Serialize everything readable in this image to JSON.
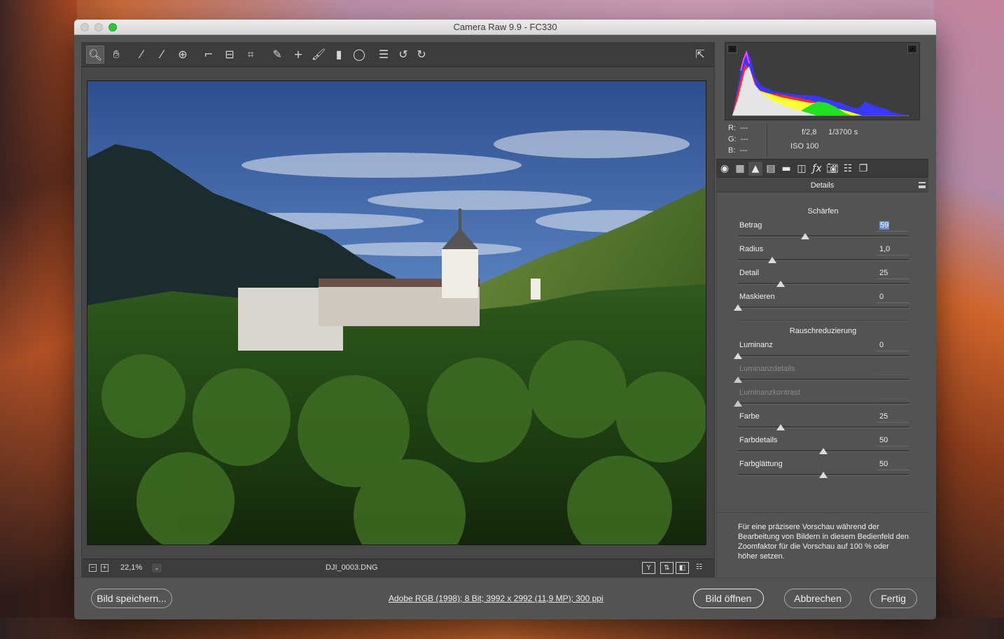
{
  "window": {
    "title": "Camera Raw 9.9 - FC330"
  },
  "toolbar": {
    "tools": [
      {
        "name": "zoom-tool-icon",
        "glyph": "🔍︎"
      },
      {
        "name": "hand-tool-icon",
        "glyph": "✋︎"
      },
      {
        "name": "white-balance-tool-icon",
        "glyph": "⁄"
      },
      {
        "name": "color-sampler-tool-icon",
        "glyph": "⁄"
      },
      {
        "name": "targeted-adjustment-tool-icon",
        "glyph": "⊕"
      },
      {
        "name": "crop-tool-icon",
        "glyph": "⌐"
      },
      {
        "name": "straighten-tool-icon",
        "glyph": "⊟"
      },
      {
        "name": "transform-tool-icon",
        "glyph": "⌗"
      },
      {
        "name": "spot-removal-tool-icon",
        "glyph": "✎"
      },
      {
        "name": "red-eye-removal-icon",
        "glyph": "+"
      },
      {
        "name": "adjustment-brush-icon",
        "glyph": "🖌︎"
      },
      {
        "name": "graduated-filter-icon",
        "glyph": "▮"
      },
      {
        "name": "radial-filter-icon",
        "glyph": "◯"
      },
      {
        "name": "preferences-icon",
        "glyph": "☰"
      },
      {
        "name": "rotate-left-icon",
        "glyph": "↺"
      },
      {
        "name": "rotate-right-icon",
        "glyph": "↻"
      }
    ],
    "fullscreen_glyph": "⇱"
  },
  "bottombar": {
    "zoom_out": "−",
    "zoom_in": "+",
    "zoom_value": "22,1%",
    "zoom_dropdown": "⌄",
    "filename": "DJI_0003.DNG",
    "view_buttons": [
      "Y",
      "⇅",
      "◧",
      "☷"
    ]
  },
  "info": {
    "r_label": "R:",
    "r_value": "---",
    "g_label": "G:",
    "g_value": "---",
    "b_label": "B:",
    "b_value": "---",
    "aperture": "f/2,8",
    "shutter": "1/3700 s",
    "iso": "ISO 100"
  },
  "tabs": [
    {
      "name": "basic-tab-icon",
      "glyph": "◉"
    },
    {
      "name": "tone-curve-tab-icon",
      "glyph": "▦"
    },
    {
      "name": "detail-tab-icon",
      "glyph": "▲"
    },
    {
      "name": "hsl-tab-icon",
      "glyph": "▤"
    },
    {
      "name": "split-toning-tab-icon",
      "glyph": "▬"
    },
    {
      "name": "lens-corrections-tab-icon",
      "glyph": "◫"
    },
    {
      "name": "effects-tab-icon",
      "glyph": "ƒx"
    },
    {
      "name": "camera-calibration-tab-icon",
      "glyph": "📷︎"
    },
    {
      "name": "presets-tab-icon",
      "glyph": "☷"
    },
    {
      "name": "snapshots-tab-icon",
      "glyph": "❐"
    }
  ],
  "panel": {
    "title": "Details",
    "sharpening": {
      "title": "Schärfen",
      "rows": [
        {
          "label": "Betrag",
          "value": "59",
          "min": 0,
          "max": 150,
          "num": 59
        },
        {
          "label": "Radius",
          "value": "1,0",
          "min": 0.5,
          "max": 3.0,
          "num": 1.0
        },
        {
          "label": "Detail",
          "value": "25",
          "min": 0,
          "max": 100,
          "num": 25
        },
        {
          "label": "Maskieren",
          "value": "0",
          "min": 0,
          "max": 100,
          "num": 0
        }
      ]
    },
    "noise": {
      "title": "Rauschreduzierung",
      "rows": [
        {
          "label": "Luminanz",
          "value": "0",
          "min": 0,
          "max": 100,
          "num": 0
        },
        {
          "label": "Luminanzdetails",
          "value": "",
          "min": 0,
          "max": 100,
          "num": 0,
          "disabled": true
        },
        {
          "label": "Luminanzkontrast",
          "value": "",
          "min": 0,
          "max": 100,
          "num": 0,
          "disabled": true
        },
        {
          "label": "Farbe",
          "value": "25",
          "min": 0,
          "max": 100,
          "num": 25
        },
        {
          "label": "Farbdetails",
          "value": "50",
          "min": 0,
          "max": 100,
          "num": 50
        },
        {
          "label": "Farbglättung",
          "value": "50",
          "min": 0,
          "max": 100,
          "num": 50
        }
      ]
    },
    "note": "Für eine präzisere Vorschau während der Bearbeitung von Bildern in diesem Bedienfeld den Zoomfaktor für die Vorschau auf 100 % oder höher setzen."
  },
  "footer": {
    "save_label": "Bild speichern...",
    "workflow_label": "Adobe RGB (1998); 8 Bit; 3992 x 2992 (11,9 MP); 300 ppi",
    "open_label": "Bild öffnen",
    "cancel_label": "Abbrechen",
    "done_label": "Fertig"
  },
  "colors": {
    "window_bg": "#535353",
    "highlight": "#6b8ecf",
    "traffic_zoom": "#2ec540"
  }
}
